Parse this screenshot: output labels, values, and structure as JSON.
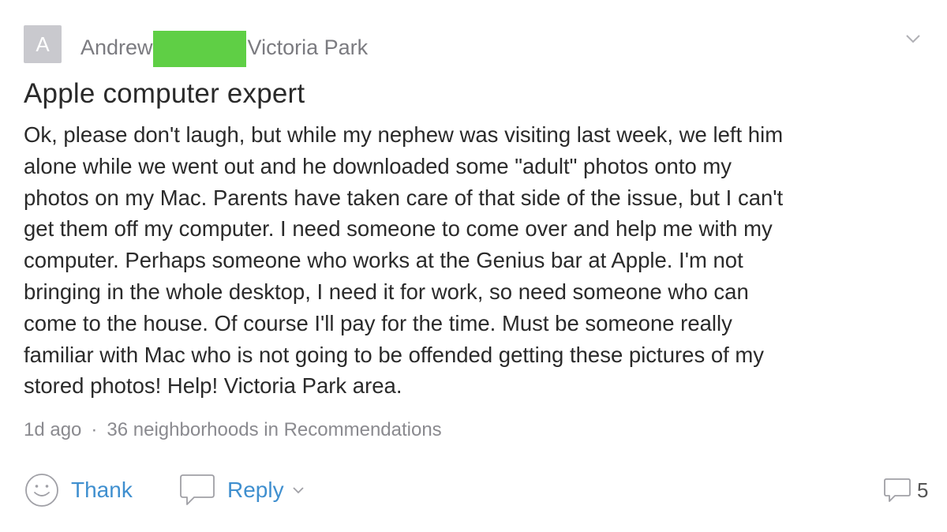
{
  "author": {
    "avatar_letter": "A",
    "first_name": "Andrew",
    "neighborhood": "Victoria Park",
    "redaction_color": "#5fcf45"
  },
  "post": {
    "title": "Apple computer expert",
    "body_lines": [
      "Ok, please don't laugh, but while my nephew was visiting last week, we left him",
      "alone while we went out and he downloaded some \"adult\" photos onto my",
      "photos on my Mac.  Parents have taken care of that side of the issue, but I can't",
      "get them off my computer.  I need someone to come over and help me with my",
      "computer.  Perhaps someone who works at the Genius bar at Apple.  I'm not",
      "bringing in the whole desktop, I need it for work, so need someone who can",
      "come to the house.  Of course I'll pay for the time.  Must be someone really",
      "familiar with Mac who is not going to be offended getting these pictures of my",
      "stored photos!  Help!  Victoria Park area."
    ]
  },
  "meta": {
    "time": "1d ago",
    "separator": "·",
    "audience": "36 neighborhoods in Recommendations"
  },
  "actions": {
    "thank_label": "Thank",
    "reply_label": "Reply",
    "comment_count": "5"
  },
  "colors": {
    "accent": "#3f8fcf",
    "muted": "#8a8a8f"
  },
  "icons": {
    "menu": "chevron-down-icon",
    "thank": "smiley-icon",
    "reply": "speech-bubble-icon",
    "comments": "comment-bubble-icon"
  }
}
